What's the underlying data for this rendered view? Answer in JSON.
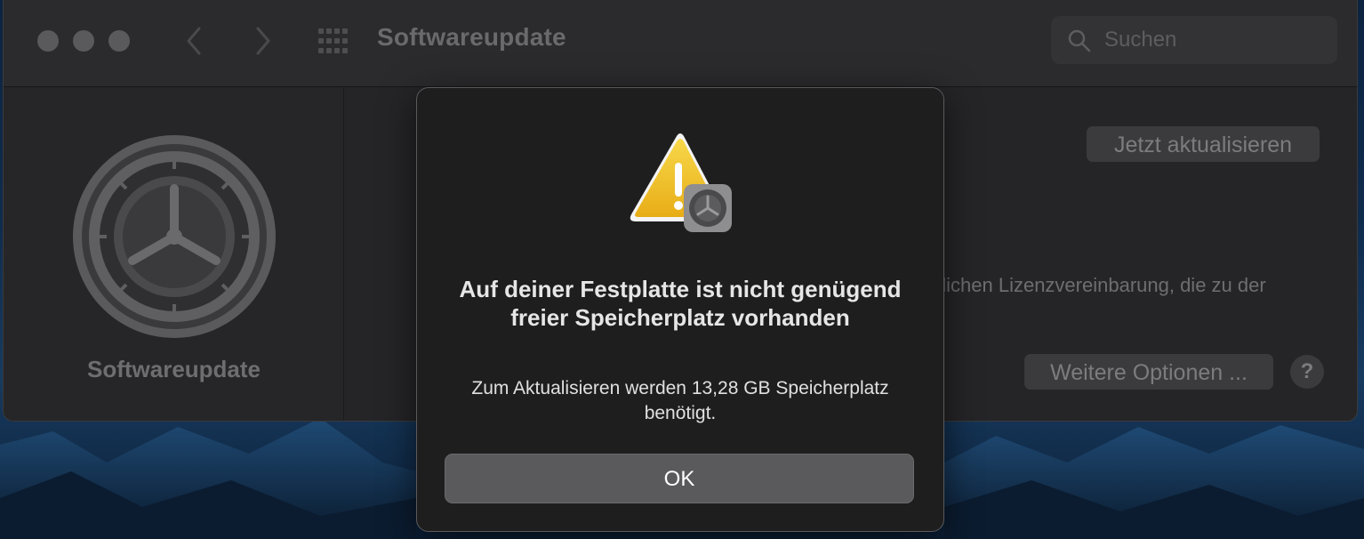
{
  "window": {
    "title": "Softwareupdate",
    "search_placeholder": "Suchen"
  },
  "sidebar": {
    "label": "Softwareupdate",
    "icon": "gear-icon"
  },
  "content": {
    "update_button": "Jetzt aktualisieren",
    "license_fragment": "glichen Lizenzvereinbarung, die zu der",
    "more_options_button": "Weitere Optionen ...",
    "help_button": "?"
  },
  "alert": {
    "icon": "warning-icon",
    "title": "Auf deiner Festplatte ist nicht genügend freier Speicherplatz vorhanden",
    "message": "Zum Aktualisieren werden 13,28 GB Speicherplatz benötigt.",
    "ok_button": "OK"
  },
  "colors": {
    "window_bg": "#252527",
    "dialog_bg": "#1e1e1f",
    "warning_yellow": "#f2c12e",
    "ok_button": "#5a5a5c"
  }
}
